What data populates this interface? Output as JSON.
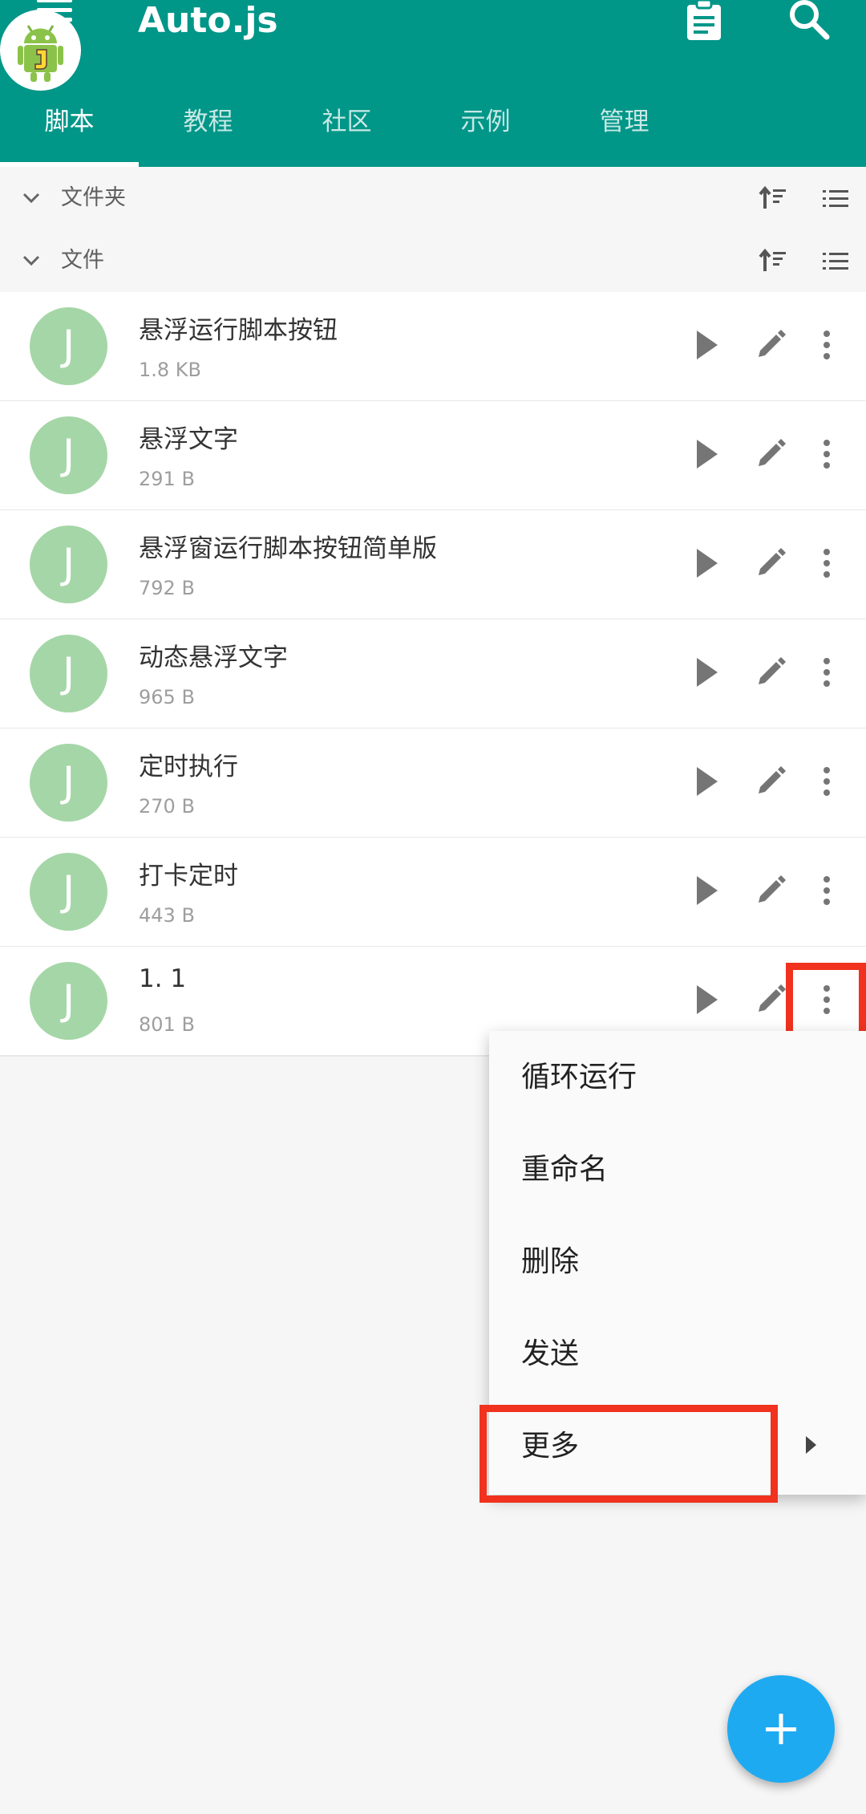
{
  "app": {
    "title": "Auto.js"
  },
  "tabs": [
    {
      "label": "脚本",
      "active": true
    },
    {
      "label": "教程",
      "active": false
    },
    {
      "label": "社区",
      "active": false
    },
    {
      "label": "示例",
      "active": false
    },
    {
      "label": "管理",
      "active": false
    }
  ],
  "sections": {
    "folders": {
      "label": "文件夹"
    },
    "files": {
      "label": "文件"
    }
  },
  "files": [
    {
      "avatar": "J",
      "name": "悬浮运行脚本按钮",
      "size": "1.8 KB"
    },
    {
      "avatar": "J",
      "name": "悬浮文字",
      "size": "291 B"
    },
    {
      "avatar": "J",
      "name": "悬浮窗运行脚本按钮简单版",
      "size": "792 B"
    },
    {
      "avatar": "J",
      "name": "动态悬浮文字",
      "size": "965 B"
    },
    {
      "avatar": "J",
      "name": "定时执行",
      "size": "270 B"
    },
    {
      "avatar": "J",
      "name": "打卡定时",
      "size": "443 B"
    },
    {
      "avatar": "J",
      "name": "1. 1",
      "size": "801 B"
    }
  ],
  "popup_menu": {
    "items": [
      {
        "label": "循环运行"
      },
      {
        "label": "重命名"
      },
      {
        "label": "删除"
      },
      {
        "label": "发送"
      },
      {
        "label": "更多",
        "has_submenu": true
      }
    ]
  },
  "icons": {
    "menu": "menu-icon",
    "doc": "clipboard-icon",
    "search": "search-icon",
    "play": "play-icon",
    "edit": "pencil-icon",
    "more": "more-vert-icon",
    "fab": "plus-icon",
    "sort": "sort-icon",
    "list": "list-icon",
    "chevron": "chevron-down-icon"
  },
  "colors": {
    "primary": "#009688",
    "avatar": "#a5d6a7",
    "fab": "#1eaaf1",
    "highlight": "#f0321e"
  }
}
